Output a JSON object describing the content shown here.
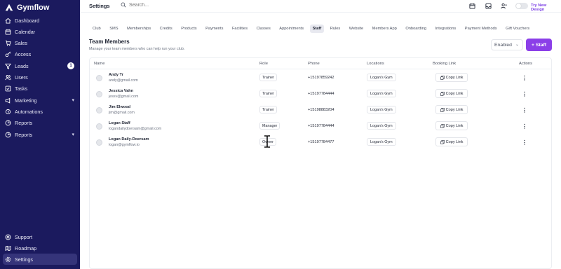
{
  "app": {
    "name": "Gymflow"
  },
  "sidebar": {
    "items": [
      {
        "label": "Dashboard",
        "icon": "home-icon"
      },
      {
        "label": "Calendar",
        "icon": "calendar-icon"
      },
      {
        "label": "Sales",
        "icon": "cart-icon"
      },
      {
        "label": "Access",
        "icon": "key-icon"
      },
      {
        "label": "Leads",
        "icon": "funnel-icon",
        "badge": "1"
      },
      {
        "label": "Users",
        "icon": "users-icon"
      },
      {
        "label": "Tasks",
        "icon": "tasks-icon"
      },
      {
        "label": "Marketing",
        "icon": "megaphone-icon",
        "expandable": true
      },
      {
        "label": "Automations",
        "icon": "automation-icon"
      },
      {
        "label": "Reports",
        "icon": "chart-icon"
      },
      {
        "label": "Reports",
        "icon": "chart-icon",
        "expandable": true
      }
    ],
    "footer": [
      {
        "label": "Support",
        "icon": "help-icon"
      },
      {
        "label": "Roadmap",
        "icon": "map-icon"
      },
      {
        "label": "Settings",
        "icon": "gear-icon",
        "active": true
      }
    ]
  },
  "topbar": {
    "title": "Settings",
    "search_placeholder": "Search...",
    "try_new_design": "Try New Design"
  },
  "tabs": [
    {
      "label": "Club"
    },
    {
      "label": "SMS"
    },
    {
      "label": "Memberships"
    },
    {
      "label": "Credits"
    },
    {
      "label": "Products"
    },
    {
      "label": "Payments"
    },
    {
      "label": "Facilities"
    },
    {
      "label": "Classes"
    },
    {
      "label": "Appointments"
    },
    {
      "label": "Staff",
      "active": true
    },
    {
      "label": "Rules"
    },
    {
      "label": "Website"
    },
    {
      "label": "Members App"
    },
    {
      "label": "Onboarding"
    },
    {
      "label": "Integrations"
    },
    {
      "label": "Payment Methods"
    },
    {
      "label": "Gift Vouchers"
    }
  ],
  "team": {
    "title": "Team Members",
    "subtitle": "Manage your team members who can help run your club.",
    "filter_value": "Enabled",
    "add_button": "Staff"
  },
  "table": {
    "headers": {
      "name": "Name",
      "role": "Role",
      "phone": "Phone",
      "locations": "Locations",
      "booking": "Booking Link",
      "actions": "Actions"
    },
    "copy_label": "Copy Link",
    "rows": [
      {
        "name": "Andy Tr",
        "email": "andy@gmail.com",
        "role": "Trainer",
        "phone": "+15197859242",
        "location": "Logan's Gym"
      },
      {
        "name": "Jessica Vahn",
        "email": "jessv@gmail.com",
        "role": "Trainer",
        "phone": "+15197784444",
        "location": "Logan's Gym"
      },
      {
        "name": "Jim Elwood",
        "email": "jim@gmail.com",
        "role": "Trainer",
        "phone": "+15198883204",
        "location": "Logan's Gym"
      },
      {
        "name": "Logan Staff",
        "email": "logandailydoersam@gmail.com",
        "role": "Manager",
        "phone": "+15197784444",
        "location": "Logan's Gym"
      },
      {
        "name": "Logan Daily-Doersam",
        "email": "logan@gymflow.io",
        "role": "Owner",
        "phone": "+15197784477",
        "location": "Logan's Gym"
      }
    ]
  },
  "colors": {
    "sidebar_bg": "#1b1a5e",
    "accent": "#8b3fe8",
    "active_nav": "#35347a"
  }
}
